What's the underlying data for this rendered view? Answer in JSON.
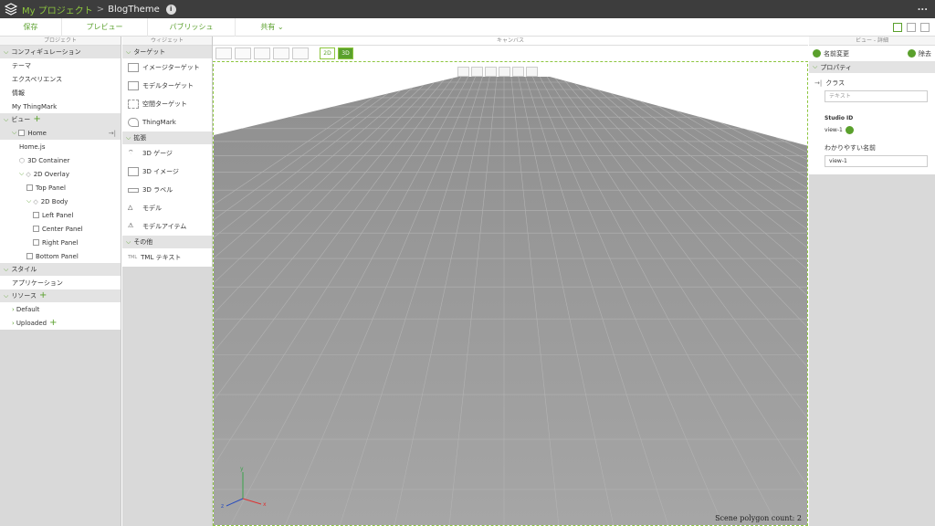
{
  "titlebar": {
    "project": "My プロジェクト",
    "separator": ">",
    "theme": "BlogTheme",
    "info": "i",
    "more": "..."
  },
  "toolbar": {
    "save": "保存",
    "preview": "プレビュー",
    "publish": "パブリッシュ",
    "share": "共有"
  },
  "project": {
    "header": "プロジェクト",
    "config_section": "コンフィギュレーション",
    "config_items": [
      "テーマ",
      "エクスペリエンス",
      "情報",
      "My ThingMark"
    ],
    "view_section": "ビュー",
    "tree": [
      "Home",
      "Home.js",
      "3D Container",
      "2D Overlay",
      "Top Panel",
      "2D Body",
      "Left Panel",
      "Center Panel",
      "Right Panel",
      "Bottom Panel"
    ],
    "style_section": "スタイル",
    "style_items": [
      "アプリケーション"
    ],
    "resource_section": "リソース",
    "resource_items": [
      "Default",
      "Uploaded"
    ]
  },
  "widgets": {
    "header": "ウィジェット",
    "target_section": "ターゲット",
    "targets": [
      "イメージターゲット",
      "モデルターゲット",
      "空間ターゲット",
      "ThingMark"
    ],
    "ext_section": "拡張",
    "ext": [
      "3D ゲージ",
      "3D イメージ",
      "3D ラベル",
      "モデル",
      "モデルアイテム"
    ],
    "other_section": "その他",
    "other": [
      "TML テキスト"
    ],
    "tml_prefix": "TML"
  },
  "canvas": {
    "header": "キャンバス",
    "btn_2d": "2D",
    "btn_3d": "3D",
    "polycount": "Scene polygon count: 2",
    "axes": {
      "x": "x",
      "y": "y",
      "z": "z"
    }
  },
  "detail": {
    "header": "ビュー - 詳細",
    "rename": "名前変更",
    "delete": "除去",
    "prop_section": "プロパティ",
    "class_label": "クラス",
    "class_placeholder": "テキスト",
    "studio_id_label": "Studio ID",
    "studio_id_value": "view-1",
    "friendly_label": "わかりやすい名前",
    "friendly_value": "view-1"
  },
  "colors": {
    "accent": "#5aa02c",
    "titlebar": "#3d3d3d",
    "grid_floor": "#9c9c9c"
  }
}
